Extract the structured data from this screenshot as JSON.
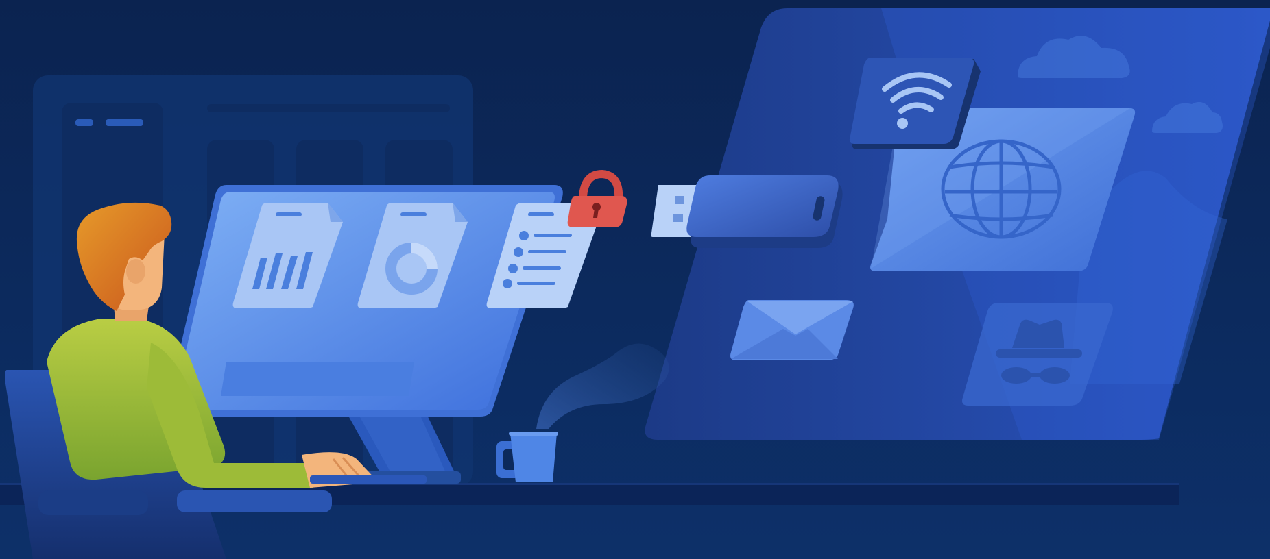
{
  "scene": {
    "kind": "illustration",
    "text_visible": false
  },
  "palette": {
    "background_top": "#0b2350",
    "background_bottom": "#0d3069",
    "backdrop_panel": "#133a78",
    "monitor_screen": "#5b8ee8",
    "monitor_screen_light": "#7fb0f5",
    "doc_card": "#a9c6f5",
    "doc_accent": "#4a7fdd",
    "lock": "#e0574f",
    "hair": "#e27a22",
    "skin": "#f3b57c",
    "shirt": "#a8c33a",
    "chair": "#1f4696",
    "network_panel": "#1e3e8f",
    "globe_card": "#6193ea",
    "usb_body": "#3f68c8",
    "mug": "#4f86e6",
    "steam": "#2f5aa6"
  },
  "icons": [
    {
      "name": "bar-chart-document-icon"
    },
    {
      "name": "donut-chart-document-icon"
    },
    {
      "name": "list-document-icon"
    },
    {
      "name": "padlock-icon"
    },
    {
      "name": "usb-drive-icon"
    },
    {
      "name": "wifi-icon"
    },
    {
      "name": "globe-icon"
    },
    {
      "name": "envelope-icon"
    },
    {
      "name": "incognito-icon"
    },
    {
      "name": "cloud-icon"
    },
    {
      "name": "coffee-mug-icon"
    }
  ]
}
